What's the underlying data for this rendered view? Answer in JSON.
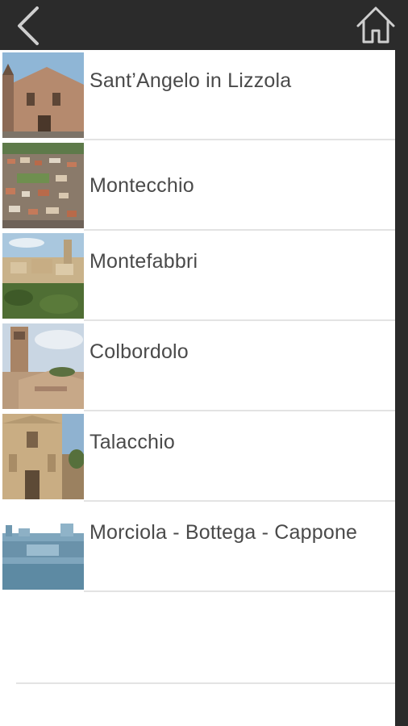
{
  "nav": {
    "back_icon": "chevron-left-icon",
    "home_icon": "home-icon",
    "bar_color": "#2b2b2b"
  },
  "list": {
    "items": [
      {
        "label": "Sant’Angelo in Lizzola",
        "thumb": "church-facade-photo"
      },
      {
        "label": "Montecchio",
        "thumb": "aerial-town-photo"
      },
      {
        "label": "Montefabbri",
        "thumb": "hilltop-village-photo"
      },
      {
        "label": "Colbordolo",
        "thumb": "bell-tower-photo"
      },
      {
        "label": "Talacchio",
        "thumb": "church-front-photo"
      },
      {
        "label": "Morciola - Bottega - Cappone",
        "thumb": "skyline-photo"
      }
    ]
  }
}
